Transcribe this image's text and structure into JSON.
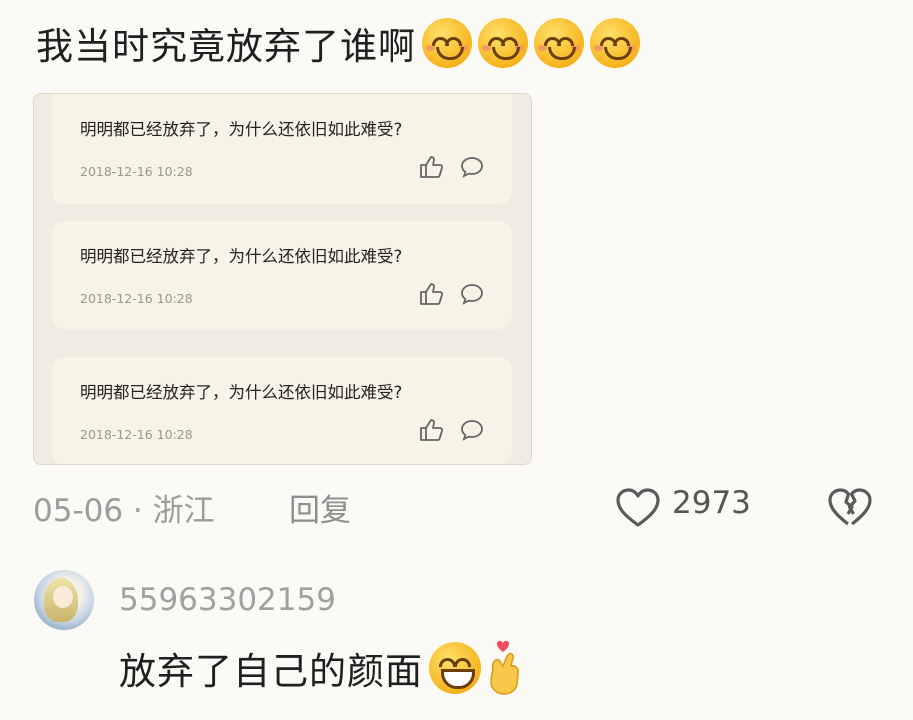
{
  "comment": {
    "text": "我当时究竟放弃了谁啊",
    "emojis": [
      "smile-emoji",
      "smile-emoji",
      "smile-emoji",
      "smile-emoji"
    ]
  },
  "embedded_screenshot": {
    "cards": [
      {
        "message": "明明都已经放弃了，为什么还依旧如此难受?",
        "time": "2018-12-16 10:28"
      },
      {
        "message": "明明都已经放弃了，为什么还依旧如此难受?",
        "time": "2018-12-16 10:28"
      },
      {
        "message": "明明都已经放弃了，为什么还依旧如此难受?",
        "time": "2018-12-16 10:28"
      }
    ]
  },
  "meta": {
    "date_location": "05-06 · 浙江",
    "reply_label": "回复",
    "like_count": "2973"
  },
  "reply_comment": {
    "username": "55963302159",
    "text": "放弃了自己的颜面",
    "emojis": [
      "grin-emoji",
      "finger-heart-icon"
    ]
  },
  "colors": {
    "background": "#fbfaf6",
    "card": "#f7f3e6",
    "meta_text": "#9c9c9c"
  }
}
